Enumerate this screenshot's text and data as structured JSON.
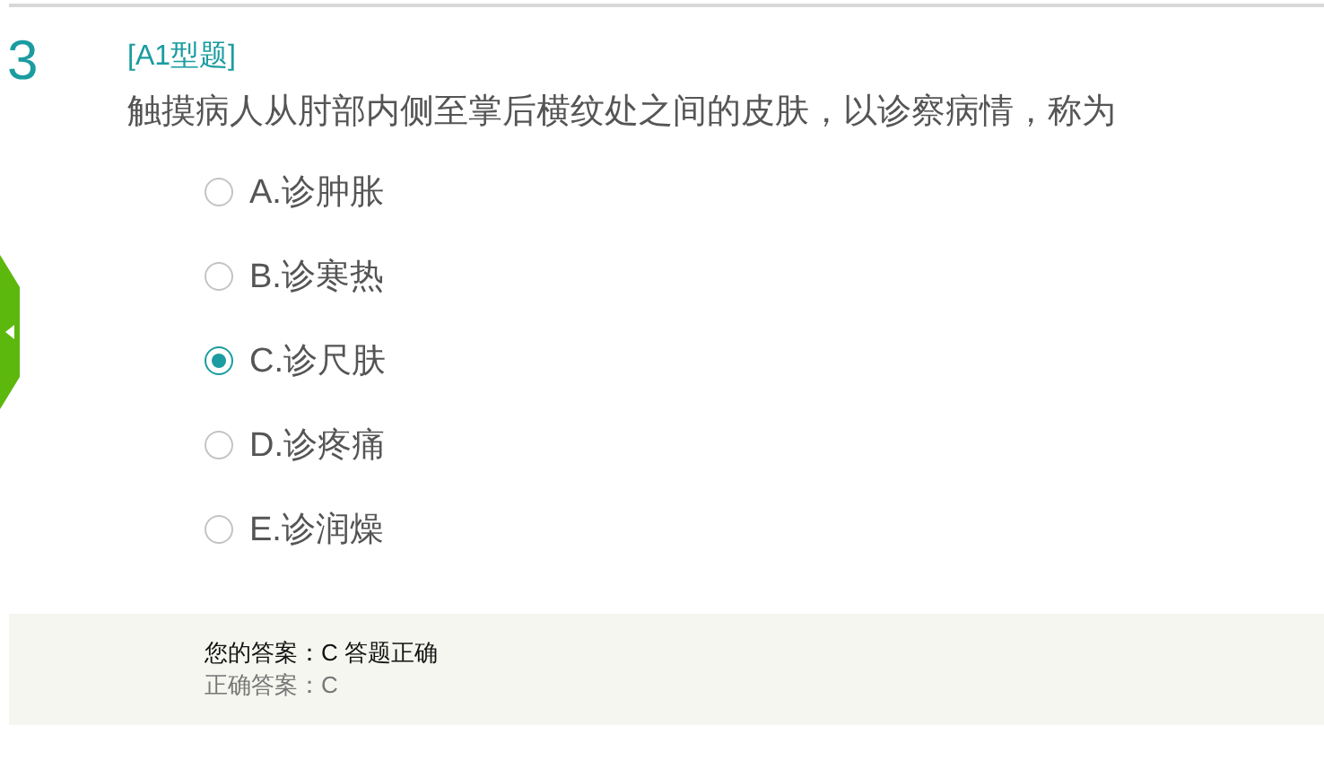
{
  "question": {
    "number": "3",
    "type": "[A1型题]",
    "text": "触摸病人从肘部内侧至掌后横纹处之间的皮肤，以诊察病情，称为"
  },
  "options": [
    {
      "label": "A.诊肿胀",
      "selected": false
    },
    {
      "label": "B.诊寒热",
      "selected": false
    },
    {
      "label": "C.诊尺肤",
      "selected": true
    },
    {
      "label": "D.诊疼痛",
      "selected": false
    },
    {
      "label": "E.诊润燥",
      "selected": false
    }
  ],
  "result": {
    "your_answer": "您的答案：C 答题正确",
    "correct_answer": "正确答案：C"
  }
}
